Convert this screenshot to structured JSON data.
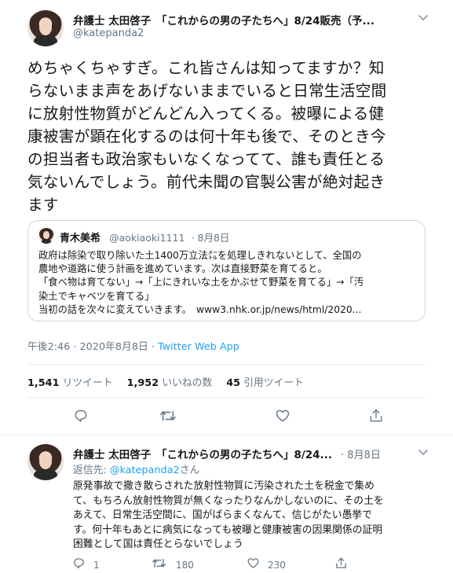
{
  "tweet": {
    "author_name": "弁護士 太田啓子　「これからの男の子たちへ」8/24販売（予...",
    "handle": "@katepanda2",
    "text": "めちゃくちゃすぎ。これ皆さんは知ってますか？知\nらないまま声をあげないままでいると日常生活空間\nに放射性物質がどんどん入ってくる。被曝による健\n康被害が顕在化するのは何十年も後で、そのとき今\nの担当者も政治家もいなくなってて、誰も責任とる\n気ないんでしょう。前代未聞の官製公害が絶対起き\nます",
    "quoted": {
      "author_name": "青木美希",
      "handle": "@aokiaoki1111",
      "date": "· 8月8日",
      "text": "政府は除染で取り除いた土1400万立法㍍を処理しきれないとして、全国の\n農地や道路に使う計画を進めています。次は直接野菜を育てると。\n「食べ物は育てない」→「上にきれいな土をかぶせて野菜を育てる」→「汚\n染土でキャベツを育てる」\n当初の話を次々に変えていきます。　www3.nhk.or.jp/news/html/2020..."
    },
    "timestamp": "午後2:46 · 2020年8月8日 · ",
    "source": "Twitter Web App",
    "retweets_count": "1,541",
    "retweets_label": "リツイート",
    "likes_count": "1,952",
    "likes_label": "いいねの数",
    "quotes_count": "45",
    "quotes_label": "引用ツイート"
  },
  "reply": {
    "author_name": "弁護士 太田啓子　「これからの男の子たちへ」8/24...",
    "date": "· 8月8日",
    "reply_to_prefix": "返信先: ",
    "reply_to_handle": "@katepanda2",
    "reply_to_suffix": "さん",
    "text": "原発事故で撒き散らされた放射性物質に汚染された土を税金で集め\nて、もちろん放射性物質が無くなったりなんかしないのに、その土を\nあえて、日常生活空間に、国がばらまくなんて、信じがたい愚挙で\nす。何十年もあとに病気になっても被曝と健康被害の因果関係の証明\n困難として国は責任とらないでしょう",
    "reply_count": "1",
    "retweet_count": "180",
    "like_count": "230"
  },
  "icons": {
    "more": "chevron-down-icon",
    "reply": "reply-icon",
    "retweet": "retweet-icon",
    "like": "heart-icon",
    "share": "share-icon"
  },
  "colors": {
    "link": "#1da1f2",
    "secondary_text": "#657786",
    "border": "#ccd6dd"
  }
}
